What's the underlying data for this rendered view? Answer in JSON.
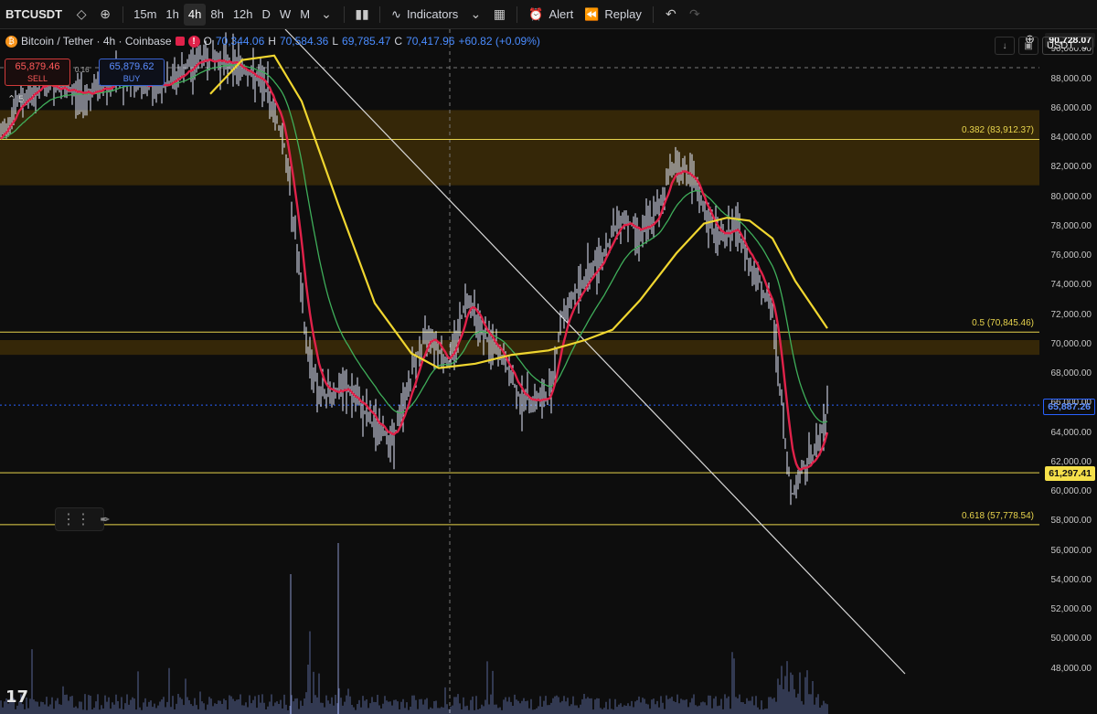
{
  "toolbar": {
    "symbol": "BTCUSDT",
    "intervals": [
      "15m",
      "1h",
      "4h",
      "8h",
      "12h",
      "D",
      "W",
      "M"
    ],
    "active_interval": "4h",
    "indicators_label": "Indicators",
    "alert_label": "Alert",
    "replay_label": "Replay"
  },
  "legend": {
    "title": "Bitcoin / Tether · 4h · Coinbase",
    "o_label": "O",
    "o_value": "70,344.06",
    "h_label": "H",
    "h_value": "70,584.36",
    "l_label": "L",
    "l_value": "69,785.47",
    "c_label": "C",
    "c_value": "70,417.96",
    "change": "+60.82 (+0.09%)"
  },
  "trade": {
    "sell_price": "65,879.46",
    "sell_label": "SELL",
    "buy_price": "65,879.62",
    "buy_label": "BUY",
    "spread": "0.16"
  },
  "indicator_collapse": "5",
  "currency": "USDT",
  "price_axis": {
    "ticks": [
      "90,000.00",
      "88,000.00",
      "86,000.00",
      "84,000.00",
      "82,000.00",
      "80,000.00",
      "78,000.00",
      "76,000.00",
      "74,000.00",
      "72,000.00",
      "70,000.00",
      "68,000.00",
      "66,000.00",
      "64,000.00",
      "62,000.00",
      "60,000.00",
      "58,000.00",
      "56,000.00",
      "54,000.00",
      "52,000.00",
      "50,000.00",
      "48,000.00"
    ],
    "crosshair_price": "90,728.07",
    "last_price": "65,887.26",
    "line_price": "61,297.41"
  },
  "fib_levels": [
    {
      "label": "0.382 (83,912.37)",
      "price": 83912.37
    },
    {
      "label": "0.5 (70,845.46)",
      "price": 70845.46
    },
    {
      "label": "0.618 (57,778.54)",
      "price": 57778.54
    }
  ],
  "colors": {
    "zone": "#3a2a08",
    "fib": "#e8d44d",
    "last_price": "#2962ff",
    "line_tag": "#f5e04a",
    "candles": "#e6ecff",
    "ema_fast": "#e0224a",
    "ema_mid": "#3fae5a",
    "ema_slow": "#f0d630"
  },
  "logo": "17"
}
